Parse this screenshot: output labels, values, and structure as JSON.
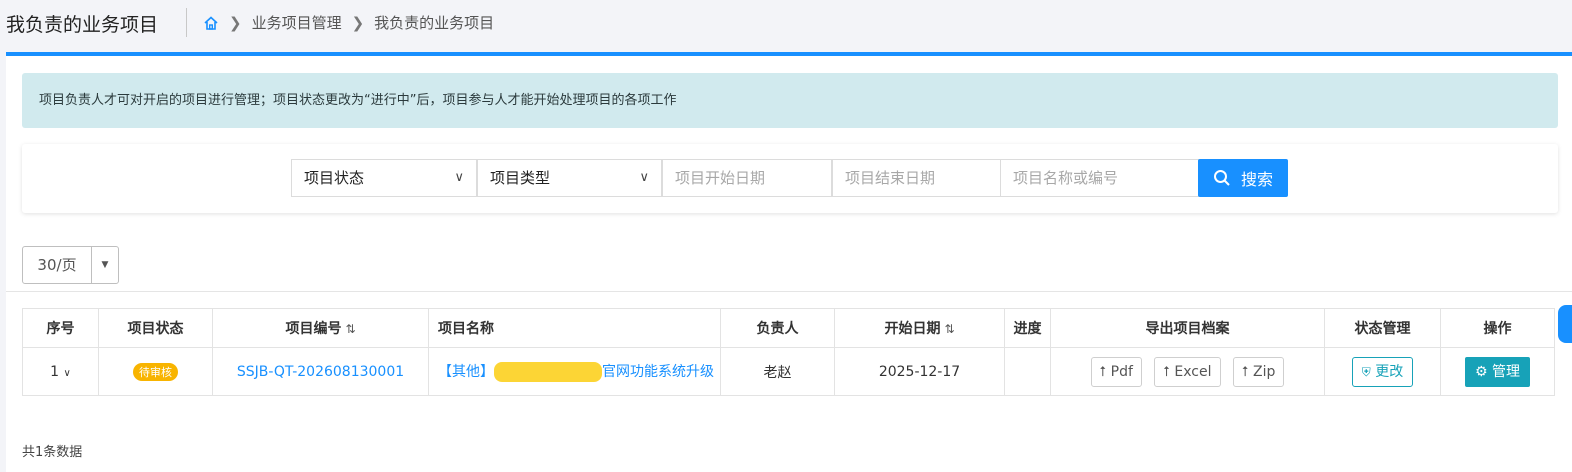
{
  "header": {
    "page_title": "我负责的业务项目",
    "breadcrumb": [
      "业务项目管理",
      "我负责的业务项目"
    ]
  },
  "notice": "项目负责人才可对开启的项目进行管理；项目状态更改为“进行中”后，项目参与人才能开始处理项目的各项工作",
  "filters": {
    "status_select": "项目状态",
    "type_select": "项目类型",
    "start_date_placeholder": "项目开始日期",
    "end_date_placeholder": "项目结束日期",
    "keyword_placeholder": "项目名称或编号",
    "search_label": "搜索"
  },
  "pager": {
    "page_size": "30/页"
  },
  "table": {
    "columns": [
      "序号",
      "项目状态",
      "项目编号",
      "项目名称",
      "负责人",
      "开始日期",
      "进度",
      "导出项目档案",
      "状态管理",
      "操作"
    ],
    "rows": [
      {
        "index": "1",
        "status": "待审核",
        "code": "SSJB-QT-202608130001",
        "name_prefix": "【其他】",
        "name_suffix": "官网功能系统升级",
        "owner": "老赵",
        "start_date": "2025-12-17",
        "progress": "",
        "export_pdf": "Pdf",
        "export_excel": "Excel",
        "export_zip": "Zip",
        "change_label": "更改",
        "manage_label": "管理"
      }
    ]
  },
  "footer": {
    "count_text": "共1条数据"
  },
  "colors": {
    "primary": "#1890ff",
    "teal": "#17a2b8",
    "badge": "#f8b400",
    "notice_bg": "#d1eaee"
  }
}
